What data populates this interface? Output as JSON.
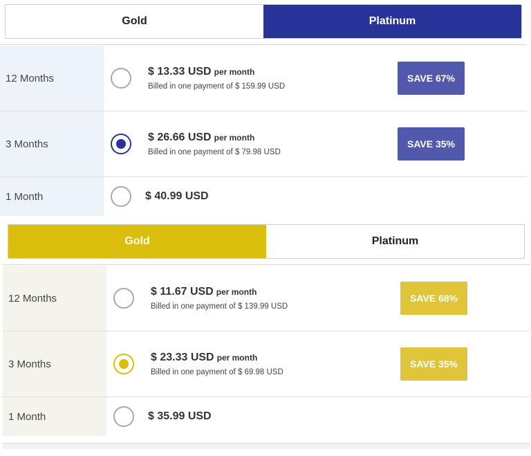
{
  "colors": {
    "platinum_accent": "#28339a",
    "gold_accent": "#dbbd0d",
    "save_blue": "#5259ad",
    "save_gold": "#e0c53a"
  },
  "platinum_panel": {
    "tabs": {
      "gold": "Gold",
      "platinum": "Platinum",
      "active": "Platinum"
    },
    "plans": [
      {
        "label": "12 Months",
        "price": "$ 13.33 USD",
        "per": "per month",
        "billed": "Billed in one payment of $ 159.99 USD",
        "save": "SAVE 67%",
        "selected": false
      },
      {
        "label": "3 Months",
        "price": "$ 26.66 USD",
        "per": "per month",
        "billed": "Billed in one payment of $ 79.98 USD",
        "save": "SAVE 35%",
        "selected": true
      },
      {
        "label": "1 Month",
        "price": "$ 40.99 USD",
        "selected": false
      }
    ]
  },
  "gold_panel": {
    "tabs": {
      "gold": "Gold",
      "platinum": "Platinum",
      "active": "Gold"
    },
    "plans": [
      {
        "label": "12 Months",
        "price": "$ 11.67 USD",
        "per": "per month",
        "billed": "Billed in one payment of $ 139.99 USD",
        "save": "SAVE 68%",
        "selected": false
      },
      {
        "label": "3 Months",
        "price": "$ 23.33 USD",
        "per": "per month",
        "billed": "Billed in one payment of $ 69.98 USD",
        "save": "SAVE 35%",
        "selected": true
      },
      {
        "label": "1 Month",
        "price": "$ 35.99 USD",
        "selected": false
      }
    ]
  }
}
